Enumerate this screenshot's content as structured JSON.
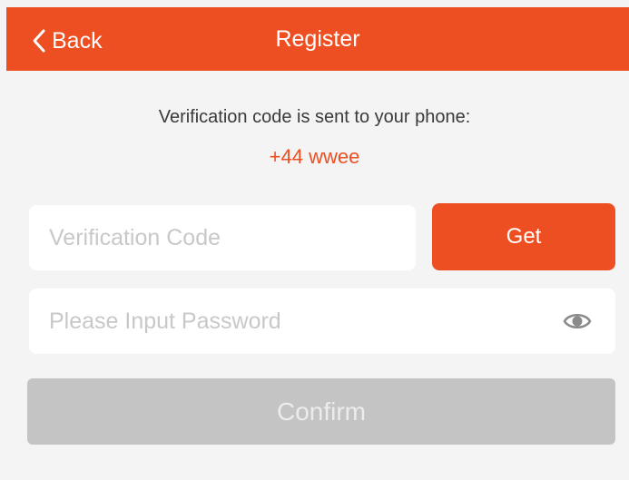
{
  "header": {
    "back_label": "Back",
    "title": "Register",
    "back_icon": "chevron-left-icon"
  },
  "info": {
    "message": "Verification code is sent to your phone:",
    "phone": "+44 wwee"
  },
  "form": {
    "code_placeholder": "Verification Code",
    "code_value": "",
    "get_label": "Get",
    "password_placeholder": "Please Input Password",
    "password_value": "",
    "eye_icon": "eye-icon",
    "confirm_label": "Confirm"
  },
  "colors": {
    "accent": "#ee4f22",
    "background": "#f4f4f4",
    "field": "#ffffff",
    "disabled_button": "#c4c4c4"
  }
}
